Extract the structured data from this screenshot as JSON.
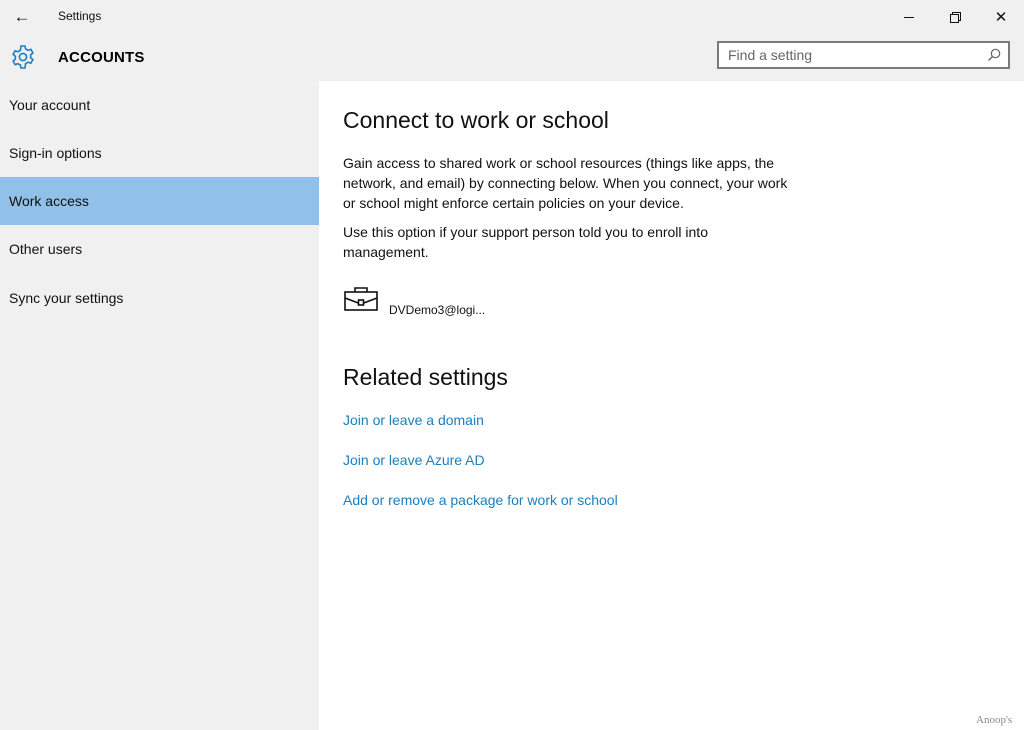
{
  "window": {
    "back_icon": "←",
    "title": "Settings",
    "close_icon": "✕"
  },
  "header": {
    "title": "ACCOUNTS",
    "search_placeholder": "Find a setting"
  },
  "sidebar": {
    "items": [
      {
        "label": "Your account"
      },
      {
        "label": "Sign-in options"
      },
      {
        "label": "Work access",
        "selected": true
      },
      {
        "label": "Other users"
      },
      {
        "label": "Sync your settings"
      }
    ]
  },
  "main": {
    "heading": "Connect to work or school",
    "paragraph1": "Gain access to shared work or school resources (things like apps, the network, and email) by connecting below. When you connect, your work or school might enforce certain policies on your device.",
    "paragraph2": "Use this option if your support person told you to enroll into management.",
    "account": {
      "name": "",
      "email": "DVDemo3@logi..."
    },
    "related_heading": "Related settings",
    "links": [
      "Join or leave a domain",
      "Join or leave Azure AD",
      "Add or remove a package for work or school"
    ]
  },
  "watermark": "Anoop's",
  "colors": {
    "selected_bg": "#91c0e8",
    "link": "#1a7fc0",
    "accent": "#1a7fc0"
  }
}
